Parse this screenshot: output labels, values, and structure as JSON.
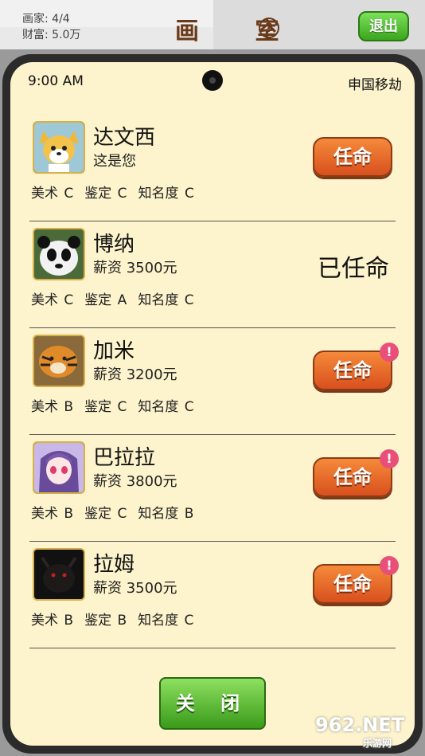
{
  "header": {
    "painters": "画家: 4/4",
    "wealth": "财富: 5.0万",
    "title": "画 室",
    "exit_label": "退出"
  },
  "status_bar": {
    "time": "9:00 AM",
    "carrier": "申国移劫"
  },
  "staff": [
    {
      "name": "达文西",
      "subtitle": "这是您",
      "skills": [
        "美术 C",
        "鉴定 C",
        "知名度 C"
      ],
      "action": "任命",
      "badge": "",
      "avatar": "fox-avatar"
    },
    {
      "name": "博纳",
      "subtitle": "薪资 3500元",
      "skills": [
        "美术 C",
        "鉴定 A",
        "知名度 C"
      ],
      "action": "已任命",
      "badge": "",
      "avatar": "panda-avatar"
    },
    {
      "name": "加米",
      "subtitle": "薪资 3200元",
      "skills": [
        "美术 B",
        "鉴定 C",
        "知名度 C"
      ],
      "action": "任命",
      "badge": "!",
      "avatar": "tiger-avatar"
    },
    {
      "name": "巴拉拉",
      "subtitle": "薪资 3800元",
      "skills": [
        "美术 B",
        "鉴定 C",
        "知名度 B"
      ],
      "action": "任命",
      "badge": "!",
      "avatar": "anime-girl-avatar"
    },
    {
      "name": "拉姆",
      "subtitle": "薪资 3500元",
      "skills": [
        "美术 B",
        "鉴定 B",
        "知名度 C"
      ],
      "action": "任命",
      "badge": "!",
      "avatar": "dark-creature-avatar"
    }
  ],
  "close_label": "关 闭",
  "watermark": {
    "main": "962.NET",
    "sub": "乐游网"
  }
}
